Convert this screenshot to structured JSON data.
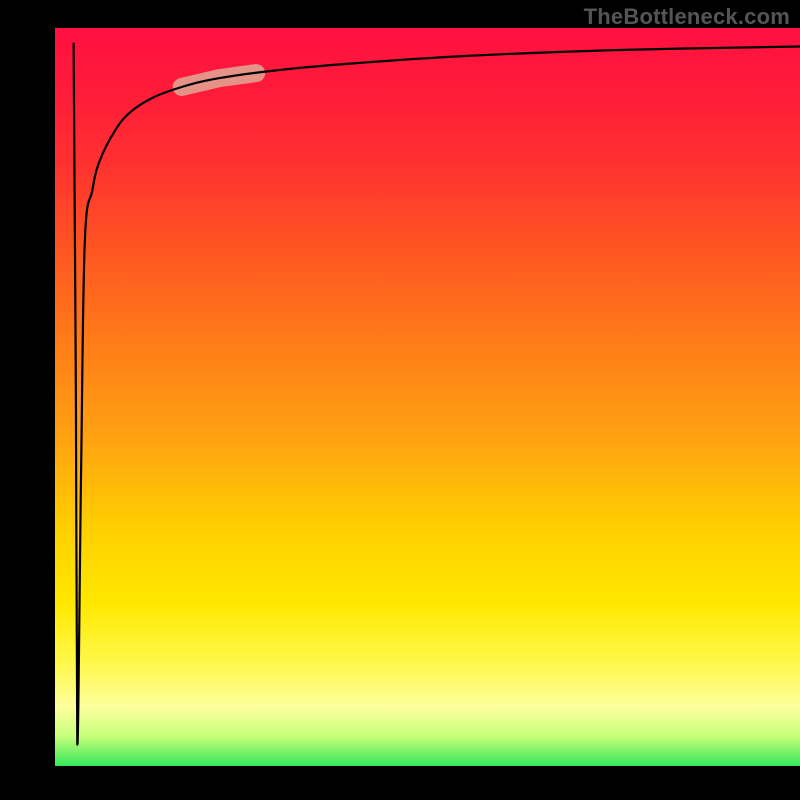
{
  "watermark": "TheBottleneck.com",
  "colors": {
    "gradient_top": "#ff1040",
    "gradient_mid_orange": "#ff7a18",
    "gradient_yellow": "#ffe800",
    "gradient_bottom_green": "#35e75a",
    "highlight": "#e2a090",
    "curve": "#000000",
    "frame": "#000000"
  },
  "chart_data": {
    "type": "line",
    "title": "",
    "xlabel": "",
    "ylabel": "",
    "xlim": [
      0,
      100
    ],
    "ylim": [
      0,
      100
    ],
    "background": "vertical gradient red→orange→yellow→green",
    "series": [
      {
        "name": "curve",
        "x": [
          2.5,
          3.0,
          4.0,
          5.0,
          6.0,
          8.0,
          10.0,
          13.0,
          17.0,
          22.0,
          30.0,
          40.0,
          55.0,
          75.0,
          100.0
        ],
        "y": [
          3.0,
          55.0,
          71.0,
          78.0,
          82.0,
          86.0,
          88.5,
          90.5,
          92.0,
          93.2,
          94.3,
          95.2,
          96.2,
          97.0,
          97.5
        ]
      }
    ],
    "annotations": [
      {
        "name": "highlight-segment",
        "x_range": [
          17,
          27
        ],
        "note": "thick pale-pink stroke over curve"
      }
    ]
  }
}
